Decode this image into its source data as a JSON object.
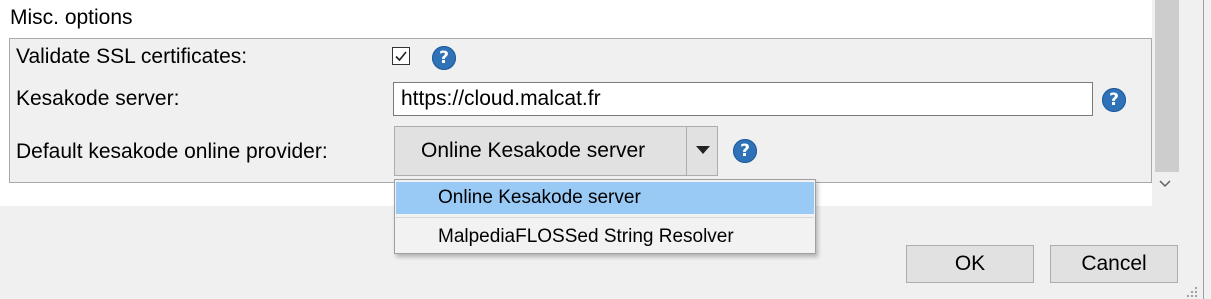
{
  "misc_options": {
    "title": "Misc. options",
    "validate_ssl": {
      "label": "Validate SSL certificates:",
      "checked": true
    },
    "kesakode_server": {
      "label": "Kesakode server:",
      "value": "https://cloud.malcat.fr"
    },
    "default_provider": {
      "label": "Default kesakode online provider:",
      "selected": "Online Kesakode server",
      "options": [
        "Online Kesakode server",
        "MalpediaFLOSSed String Resolver"
      ]
    },
    "help_glyph": "?"
  },
  "buttons": {
    "ok": "OK",
    "cancel": "Cancel"
  },
  "colors": {
    "help_icon": "#2f72b8",
    "dropdown_highlight": "#99c9f5"
  },
  "icons": [
    "checkmark-icon",
    "help-icon",
    "chevron-down-icon",
    "resize-grip-icon"
  ]
}
